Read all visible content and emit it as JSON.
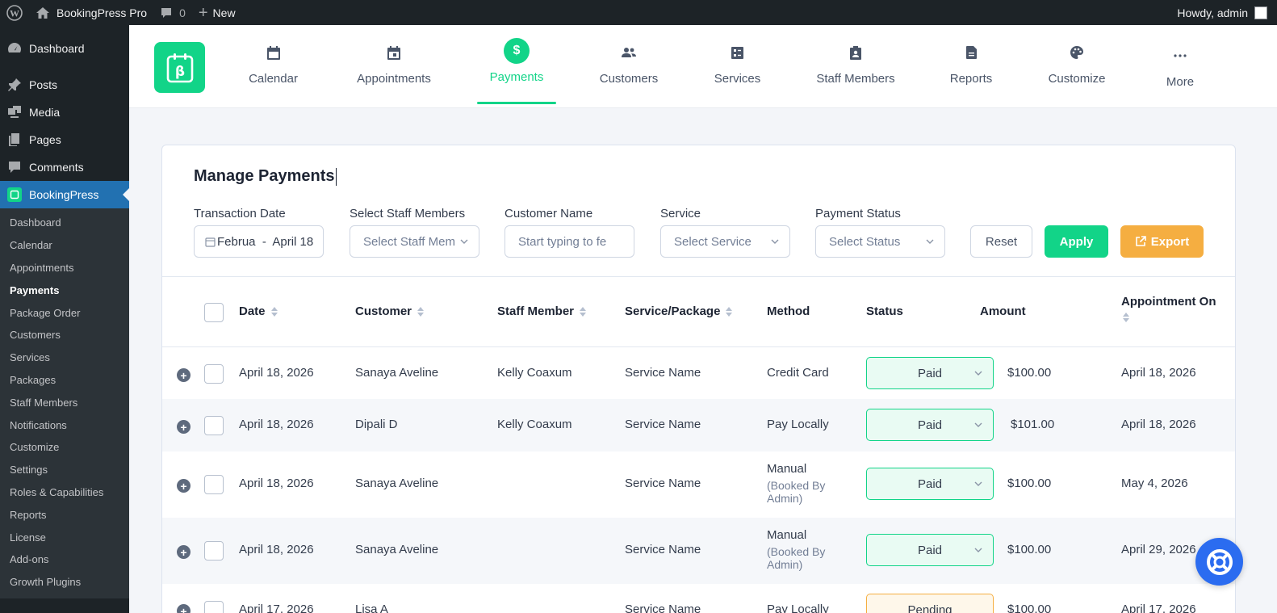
{
  "admin_bar": {
    "site_name": "BookingPress Pro",
    "comments_count": "0",
    "new_label": "New",
    "howdy": "Howdy, admin"
  },
  "sidebar": {
    "top_items": [
      {
        "label": "Dashboard",
        "icon": "dashboard-icon"
      },
      {
        "label": "Posts",
        "icon": "pin-icon"
      },
      {
        "label": "Media",
        "icon": "media-icon"
      },
      {
        "label": "Pages",
        "icon": "pages-icon"
      },
      {
        "label": "Comments",
        "icon": "comment-icon"
      },
      {
        "label": "BookingPress",
        "icon": "bookingpress-icon"
      }
    ],
    "submenu": [
      "Dashboard",
      "Calendar",
      "Appointments",
      "Payments",
      "Package Order",
      "Customers",
      "Services",
      "Packages",
      "Staff Members",
      "Notifications",
      "Customize",
      "Settings",
      "Roles & Capabilities",
      "Reports",
      "License",
      "Add-ons",
      "Growth Plugins"
    ],
    "current_sub": "Payments"
  },
  "topnav": {
    "items": [
      {
        "label": "Calendar",
        "icon": "calendar-icon"
      },
      {
        "label": "Appointments",
        "icon": "appointments-icon"
      },
      {
        "label": "Payments",
        "icon": "dollar-icon"
      },
      {
        "label": "Customers",
        "icon": "users-icon"
      },
      {
        "label": "Services",
        "icon": "services-icon"
      },
      {
        "label": "Staff Members",
        "icon": "badge-icon"
      },
      {
        "label": "Reports",
        "icon": "report-icon"
      },
      {
        "label": "Customize",
        "icon": "palette-icon"
      },
      {
        "label": "More",
        "icon": "more-icon"
      }
    ],
    "active": "Payments",
    "accent": "#12d488"
  },
  "page": {
    "title": "Manage Payments",
    "filters": {
      "transaction_date": {
        "label": "Transaction Date",
        "value": "Februa  -  April 18"
      },
      "staff": {
        "label": "Select Staff Members",
        "placeholder": "Select Staff Mem"
      },
      "customer": {
        "label": "Customer Name",
        "placeholder": "Start typing to fe"
      },
      "service": {
        "label": "Service",
        "placeholder": "Select Service"
      },
      "status": {
        "label": "Payment Status",
        "placeholder": "Select Status"
      }
    },
    "buttons": {
      "reset": "Reset",
      "apply": "Apply",
      "export": "Export"
    }
  },
  "table": {
    "columns": [
      "Date",
      "Customer",
      "Staff Member",
      "Service/Package",
      "Method",
      "Status",
      "Amount",
      "Appointment On"
    ],
    "rows": [
      {
        "date": "April 18, 2026",
        "customer": "Sanaya Aveline",
        "staff": "Kelly Coaxum",
        "service": "Service Name",
        "method": "Credit Card",
        "method_note": "",
        "status": "Paid",
        "amount": "$100.00",
        "appointment_on": "April 18, 2026"
      },
      {
        "date": "April 18, 2026",
        "customer": "Dipali D",
        "staff": "Kelly Coaxum",
        "service": "Service Name",
        "method": "Pay Locally",
        "method_note": "",
        "status": "Paid",
        "amount": "$101.00",
        "appointment_on": "April 18, 2026"
      },
      {
        "date": "April 18, 2026",
        "customer": "Sanaya Aveline",
        "staff": "",
        "service": "Service Name",
        "method": "Manual",
        "method_note": "(Booked By Admin)",
        "status": "Paid",
        "amount": "$100.00",
        "appointment_on": "May 4, 2026"
      },
      {
        "date": "April 18, 2026",
        "customer": "Sanaya Aveline",
        "staff": "",
        "service": "Service Name",
        "method": "Manual",
        "method_note": "(Booked By Admin)",
        "status": "Paid",
        "amount": "$100.00",
        "appointment_on": "April 29, 2026"
      },
      {
        "date": "April 17, 2026",
        "customer": "Lisa A",
        "staff": "",
        "service": "Service Name",
        "method": "Pay Locally",
        "method_note": "",
        "status": "Pending",
        "amount": "$100.00",
        "appointment_on": "April 17, 2026"
      }
    ]
  }
}
